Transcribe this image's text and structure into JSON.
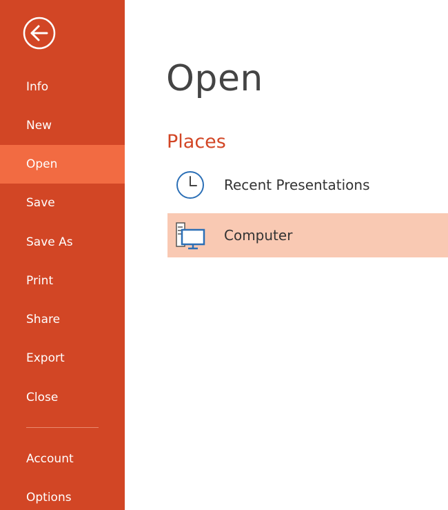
{
  "sidebar": {
    "back_icon": "back-arrow-icon",
    "items": [
      {
        "label": "Info"
      },
      {
        "label": "New"
      },
      {
        "label": "Open",
        "selected": true
      },
      {
        "label": "Save"
      },
      {
        "label": "Save As"
      },
      {
        "label": "Print"
      },
      {
        "label": "Share"
      },
      {
        "label": "Export"
      },
      {
        "label": "Close"
      }
    ],
    "bottom_items": [
      {
        "label": "Account"
      },
      {
        "label": "Options"
      }
    ]
  },
  "main": {
    "title": "Open",
    "section_title": "Places",
    "places": [
      {
        "label": "Recent Presentations",
        "icon": "clock-icon",
        "selected": false
      },
      {
        "label": "Computer",
        "icon": "computer-icon",
        "selected": true
      }
    ]
  },
  "colors": {
    "sidebar_bg": "#d24625",
    "sidebar_selected": "#f26b42",
    "accent": "#d24625",
    "place_selected": "#f9c9b3",
    "icon_blue": "#2b6fb6"
  }
}
